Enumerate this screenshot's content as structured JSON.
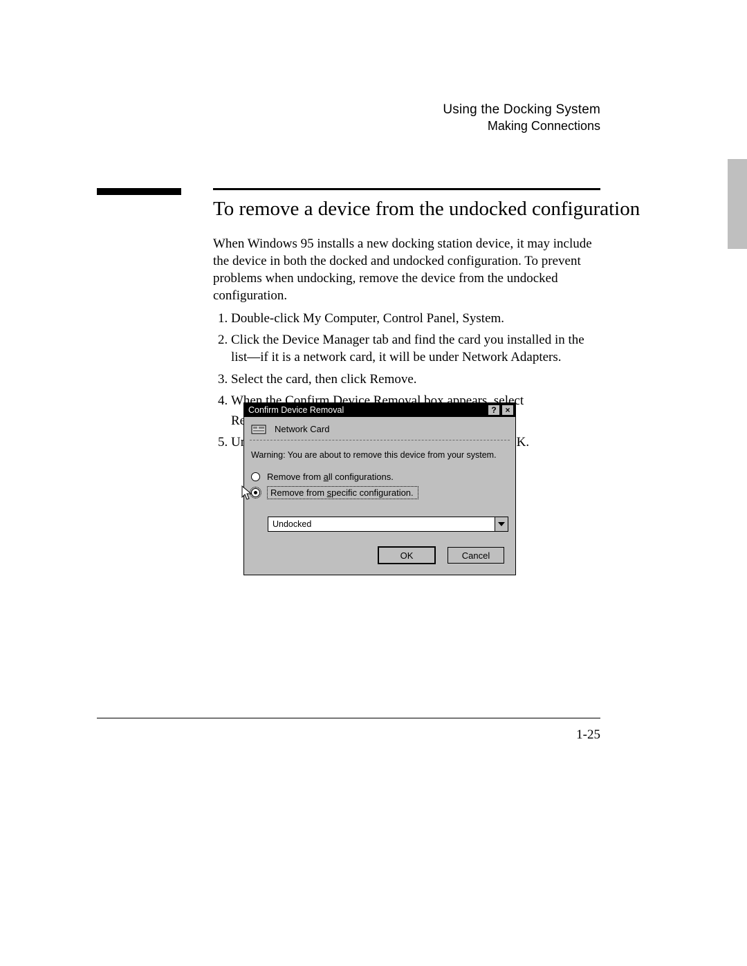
{
  "header": {
    "line1": "Using the Docking System",
    "line2": "Making Connections"
  },
  "section_title": "To remove a device from the undocked configuration",
  "intro": "When Windows 95 installs a new docking station device, it may include the device in both the docked and undocked configuration. To prevent problems when undocking, remove the device from the undocked configuration.",
  "steps": {
    "s1": "Double-click My Computer, Control Panel, System.",
    "s2": "Click the Device Manager tab and find the card you installed in the list—if it is a network card, it will be under Network Adapters.",
    "s3": "Select the card, then click Remove.",
    "s4a": "When the Confirm Device Removal box appears, select",
    "s4b": "Remove From Specific Configuration.",
    "s5": "Under Configuration, select Undocked, then choose OK."
  },
  "dialog": {
    "title": "Confirm Device Removal",
    "help_glyph": "?",
    "close_glyph": "×",
    "device_name": "Network Card",
    "warning": "Warning: You are about to remove this device from your system.",
    "opt_all_pre": "Remove from ",
    "opt_all_ul": "a",
    "opt_all_post": "ll configurations.",
    "opt_spec_pre": "Remove from ",
    "opt_spec_ul": "s",
    "opt_spec_post": "pecific configuration.",
    "combo_value": "Undocked",
    "ok": "OK",
    "cancel": "Cancel"
  },
  "page_number": "1-25"
}
